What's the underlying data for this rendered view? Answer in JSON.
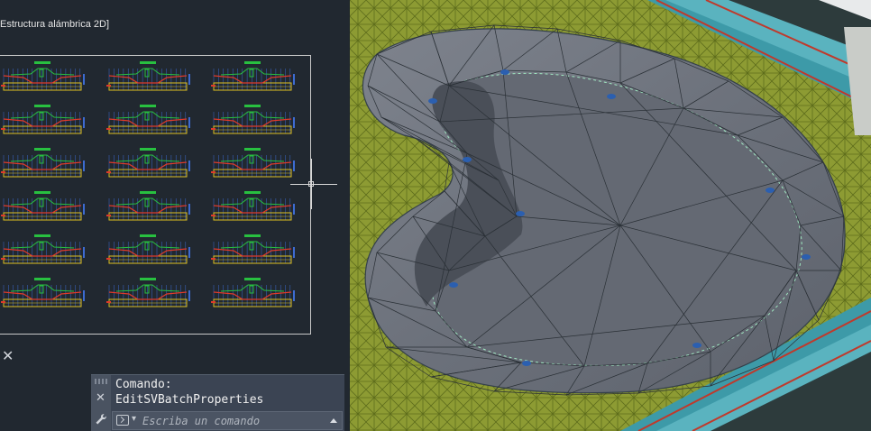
{
  "viewport": {
    "label": "Estructura alámbrica 2D]"
  },
  "command_line": {
    "history_label": "Comando:",
    "history_command": "EditSVBatchProperties",
    "input_placeholder": "Escriba un comando",
    "icons": {
      "close": "close-icon",
      "settings": "wrench-icon",
      "prompt": "command-prompt-icon",
      "history_toggle": "chevron-up-icon"
    }
  },
  "colors": {
    "viewport_bg": "#212830",
    "terrain_green": "#8c9a34",
    "pond_surface": "#6f747f",
    "command_bg": "#3b4453"
  }
}
